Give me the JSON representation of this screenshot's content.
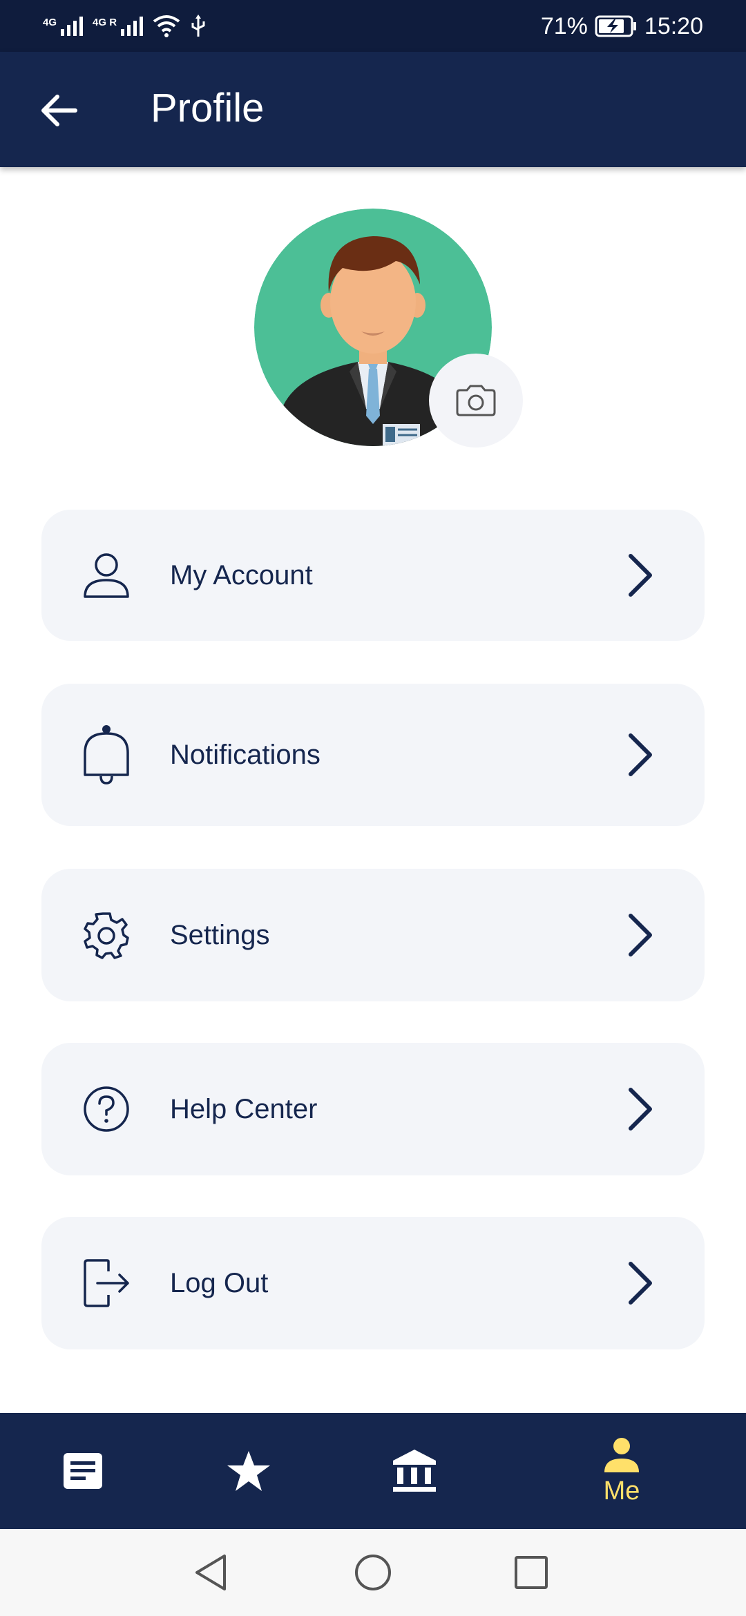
{
  "status_bar": {
    "net1": "4G",
    "net2": "4G R",
    "battery": "71%",
    "time": "15:20"
  },
  "header": {
    "title": "Profile",
    "back_icon": "arrow-left-icon"
  },
  "avatar": {
    "camera_icon": "camera-icon"
  },
  "menu": {
    "items": [
      {
        "label": "My Account",
        "icon": "user-icon"
      },
      {
        "label": "Notifications",
        "icon": "bell-icon"
      },
      {
        "label": "Settings",
        "icon": "gear-icon"
      },
      {
        "label": "Help Center",
        "icon": "help-circle-icon"
      },
      {
        "label": "Log Out",
        "icon": "logout-icon"
      }
    ]
  },
  "bottom_nav": {
    "items": [
      {
        "icon": "document-icon"
      },
      {
        "icon": "star-icon"
      },
      {
        "icon": "bank-icon"
      },
      {
        "icon": "person-icon",
        "label": "Me",
        "active": true
      }
    ]
  },
  "colors": {
    "primary": "#15264e",
    "active_nav": "#ffe06a",
    "card_bg": "#f3f5f9",
    "avatar_bg": "#4cbf96"
  }
}
